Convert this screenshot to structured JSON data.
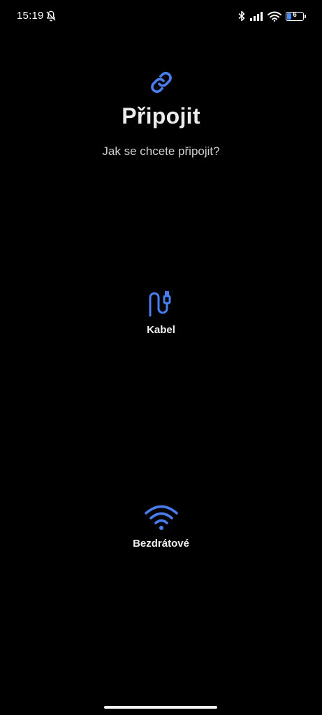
{
  "status_bar": {
    "time": "15:19",
    "battery_level": "6",
    "icons": [
      "bell-off-icon",
      "bluetooth-icon",
      "signal-icon",
      "wifi-icon",
      "battery-icon"
    ]
  },
  "header": {
    "icon": "link-icon",
    "title": "Připojit",
    "subtitle": "Jak se chcete připojit?"
  },
  "options": [
    {
      "icon": "usb-cable-icon",
      "label": "Kabel"
    },
    {
      "icon": "wifi-icon",
      "label": "Bezdrátové"
    }
  ],
  "colors": {
    "background": "#000000",
    "accent": "#4a7ef0",
    "text": "#ececec"
  }
}
